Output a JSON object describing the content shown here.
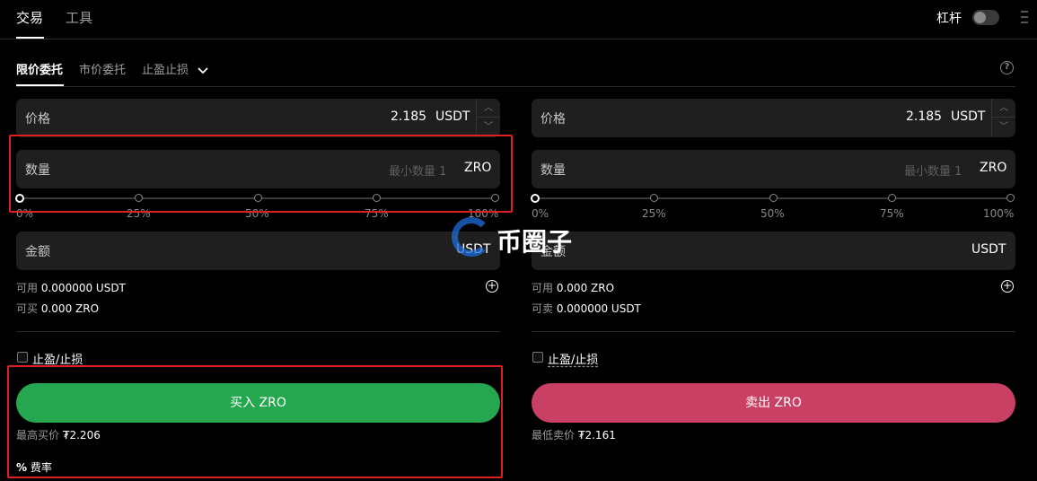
{
  "top_tabs": {
    "trade": "交易",
    "tools": "工具"
  },
  "leverage": {
    "label": "杠杆",
    "enabled": false
  },
  "order_tabs": {
    "limit": "限价委托",
    "market": "市价委托",
    "tpsl": "止盈止损"
  },
  "slider_labels": [
    "0%",
    "25%",
    "50%",
    "75%",
    "100%"
  ],
  "buy": {
    "price_label": "价格",
    "price_value": "2.185",
    "price_unit": "USDT",
    "qty_label": "数量",
    "qty_placeholder": "最小数量 1",
    "qty_unit": "ZRO",
    "amount_label": "金额",
    "amount_unit": "USDT",
    "available_label": "可用",
    "available_value": "0.000000 USDT",
    "can_label": "可买",
    "can_value": "0.000 ZRO",
    "tpsl_label": "止盈/止损",
    "button_label": "买入 ZRO",
    "best_label": "最高买价",
    "best_value": "₮2.206",
    "fee_icon": "%",
    "fee_label": "费率"
  },
  "sell": {
    "price_label": "价格",
    "price_value": "2.185",
    "price_unit": "USDT",
    "qty_label": "数量",
    "qty_placeholder": "最小数量 1",
    "qty_unit": "ZRO",
    "amount_label": "金额",
    "amount_unit": "USDT",
    "available_label": "可用",
    "available_value": "0.000 ZRO",
    "can_label": "可卖",
    "can_value": "0.000000 USDT",
    "tpsl_label": "止盈/止损",
    "button_label": "卖出 ZRO",
    "best_label": "最低卖价",
    "best_value": "₮2.161"
  },
  "watermark": "币圈子",
  "colors": {
    "buy": "#25a750",
    "sell": "#ca3f64",
    "highlight": "#e02020"
  }
}
